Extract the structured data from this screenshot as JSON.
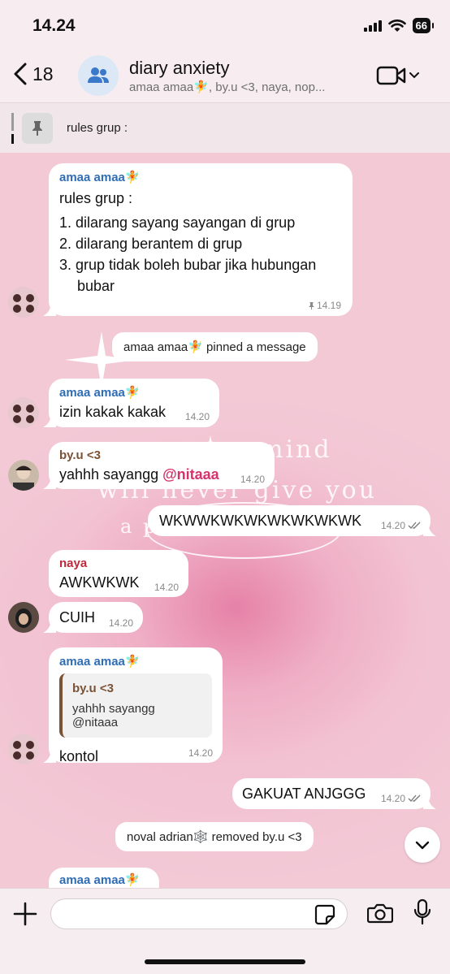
{
  "status_bar": {
    "time": "14.24",
    "battery": "66"
  },
  "header": {
    "back_count": "18",
    "title": "diary anxiety",
    "subtitle": "amaa amaa🧚, by.u <3, naya, nop..."
  },
  "pinned": {
    "text": "rules grup :"
  },
  "wallpaper": {
    "line1": "mind",
    "line2": "will never give you",
    "line3": "a positive life"
  },
  "messages": {
    "rules": {
      "sender": "amaa amaa🧚",
      "title": "rules grup :",
      "items": [
        "1. dilarang sayang sayangan di grup",
        "2. dilarang berantem di grup",
        "3. grup tidak boleh bubar jika hubungan",
        "bubar"
      ],
      "time": "14.19"
    },
    "system_pinned": {
      "actor": "amaa amaa🧚",
      "text": " pinned a message"
    },
    "izin": {
      "sender": "amaa amaa🧚",
      "text": "izin kakak kakak",
      "time": "14.20"
    },
    "yahh": {
      "sender": "by.u <3",
      "text": "yahhh sayangg ",
      "mention": "@nitaaa",
      "time": "14.20"
    },
    "wkwk": {
      "text": "WKWWKWKWKWKWKWKWK",
      "time": "14.20"
    },
    "awk": {
      "sender": "naya",
      "text": "AWKWKWK",
      "time": "14.20"
    },
    "cuih": {
      "text": "CUIH",
      "time": "14.20"
    },
    "reply": {
      "sender": "amaa amaa🧚",
      "quote_sender": "by.u <3",
      "quote_text": "yahhh sayangg @nitaaa",
      "text": "kontol",
      "time": "14.20"
    },
    "gakuat": {
      "text": "GAKUAT ANJGGG",
      "time": "14.20"
    },
    "system_removed": {
      "text": "noval adrian🕸️ removed by.u <3"
    },
    "partial": {
      "sender": "amaa amaa🧚"
    }
  },
  "colors": {
    "sender_amaa": "#2f6db5",
    "sender_byu": "#7a5236",
    "sender_naya": "#c0283a",
    "mention": "#d6336c"
  }
}
